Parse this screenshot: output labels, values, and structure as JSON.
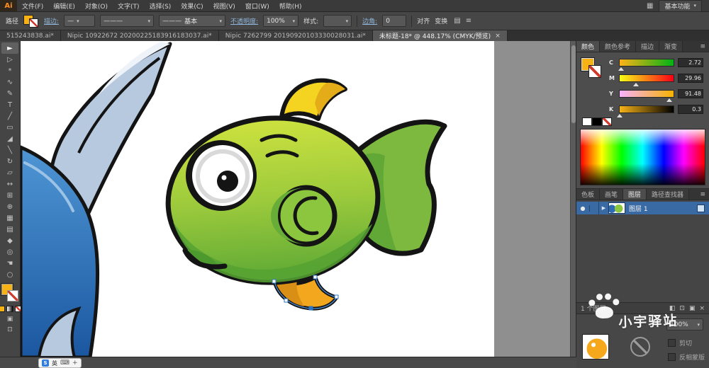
{
  "app": {
    "logo_text": "Ai",
    "workspace_switcher": "基本功能"
  },
  "glyphs": {
    "caret": "▾",
    "close": "×",
    "panel_menu": "≡",
    "disclosure": "▶",
    "eye": "●",
    "stroke_weight_preview": "—",
    "width_profile_preview": "———"
  },
  "menubar": {
    "items": [
      "文件(F)",
      "编辑(E)",
      "对象(O)",
      "文字(T)",
      "选择(S)",
      "效果(C)",
      "视图(V)",
      "窗口(W)",
      "帮助(H)"
    ],
    "right_icons": [
      {
        "name": "arrange-documents-icon",
        "glyph": "▦"
      }
    ]
  },
  "controlbar": {
    "context_label": "路径",
    "stroke_label": "描边:",
    "brush_value": "基本",
    "opacity_label": "不透明度:",
    "opacity_value": "100%",
    "style_label": "样式:",
    "corner_label": "边角:",
    "corner_value": "0",
    "align_label": "对齐",
    "transform_label": "变换",
    "icons": [
      {
        "name": "align-panel-icon",
        "glyph": "▤"
      },
      {
        "name": "options-menu-icon",
        "glyph": "≡"
      }
    ]
  },
  "tabbar": {
    "tabs": [
      {
        "title": "515243838.ai*"
      },
      {
        "title": "Nipic 10922672 20200225183916183037.ai*"
      },
      {
        "title": "Nipic 7262799 20190920103330028031.ai*"
      },
      {
        "title": "未标题-18* @ 448.17% (CMYK/预览)"
      }
    ]
  },
  "toolbar": {
    "tools": [
      {
        "name": "selection-tool",
        "glyph": "►"
      },
      {
        "name": "direct-selection-tool",
        "glyph": "▷"
      },
      {
        "name": "magic-wand-tool",
        "glyph": "*"
      },
      {
        "name": "lasso-tool",
        "glyph": "∿"
      },
      {
        "name": "pen-tool",
        "glyph": "✎"
      },
      {
        "name": "type-tool",
        "glyph": "T"
      },
      {
        "name": "line-segment-tool",
        "glyph": "╱"
      },
      {
        "name": "rectangle-tool",
        "glyph": "▭"
      },
      {
        "name": "paintbrush-tool",
        "glyph": "◢"
      },
      {
        "name": "pencil-tool",
        "glyph": "╲"
      },
      {
        "name": "rotate-tool",
        "glyph": "↻"
      },
      {
        "name": "scale-tool",
        "glyph": "▱"
      },
      {
        "name": "width-tool",
        "glyph": "↔"
      },
      {
        "name": "free-transform-tool",
        "glyph": "⊞"
      },
      {
        "name": "shape-builder-tool",
        "glyph": "⊕"
      },
      {
        "name": "mesh-tool",
        "glyph": "▦"
      },
      {
        "name": "gradient-tool",
        "glyph": "▤"
      },
      {
        "name": "eyedropper-tool",
        "glyph": "◆"
      },
      {
        "name": "blend-tool",
        "glyph": "◎"
      },
      {
        "name": "hand-tool",
        "glyph": "☚"
      },
      {
        "name": "zoom-tool",
        "glyph": "○"
      }
    ]
  },
  "color_panel": {
    "tabs": [
      "颜色",
      "颜色参考",
      "描边",
      "渐变"
    ],
    "channels": [
      {
        "label": "C",
        "value": "2.72"
      },
      {
        "label": "M",
        "value": "29.96"
      },
      {
        "label": "Y",
        "value": "91.48"
      },
      {
        "label": "K",
        "value": "0.3"
      }
    ],
    "fill_hex": "#F7B216"
  },
  "dock_tabs": {
    "tabs": [
      "色板",
      "画笔",
      "图层",
      "路径查找器"
    ]
  },
  "layers_panel": {
    "layer_name": "图层 1",
    "status": "1 个图层",
    "foot_icons": [
      {
        "name": "make-clip-mask-icon",
        "glyph": "◧"
      },
      {
        "name": "new-sublayer-icon",
        "glyph": "⊡"
      },
      {
        "name": "new-layer-icon",
        "glyph": "▣"
      },
      {
        "name": "delete-layer-icon",
        "glyph": "×"
      }
    ]
  },
  "transparency_panel": {
    "opacity_value": "100%",
    "clip_label": "剪切",
    "invert_mask_label": "反相蒙版"
  },
  "watermark": {
    "text": "小宇驿站"
  },
  "statusbar": {
    "ime_icons": [
      {
        "name": "sogou-icon",
        "glyph": "S"
      },
      {
        "name": "ime-lang-indicator",
        "glyph": "英"
      },
      {
        "name": "ime-keyboard-icon",
        "glyph": "⌨"
      },
      {
        "name": "ime-toolbox-icon",
        "glyph": "+"
      }
    ]
  },
  "canvas": {
    "zoom": "448.17%",
    "palette": {
      "fish_body_green": "#8CC63E",
      "fish_tail_green": "#7DB93F",
      "dorsal_fin_yellow": "#F5D321",
      "ventral_fin_orange": "#F2A71F",
      "blue_fish_body": "#2E6DB4",
      "blue_fish_tail": "#B7C9DE",
      "outline_black": "#141414"
    }
  }
}
